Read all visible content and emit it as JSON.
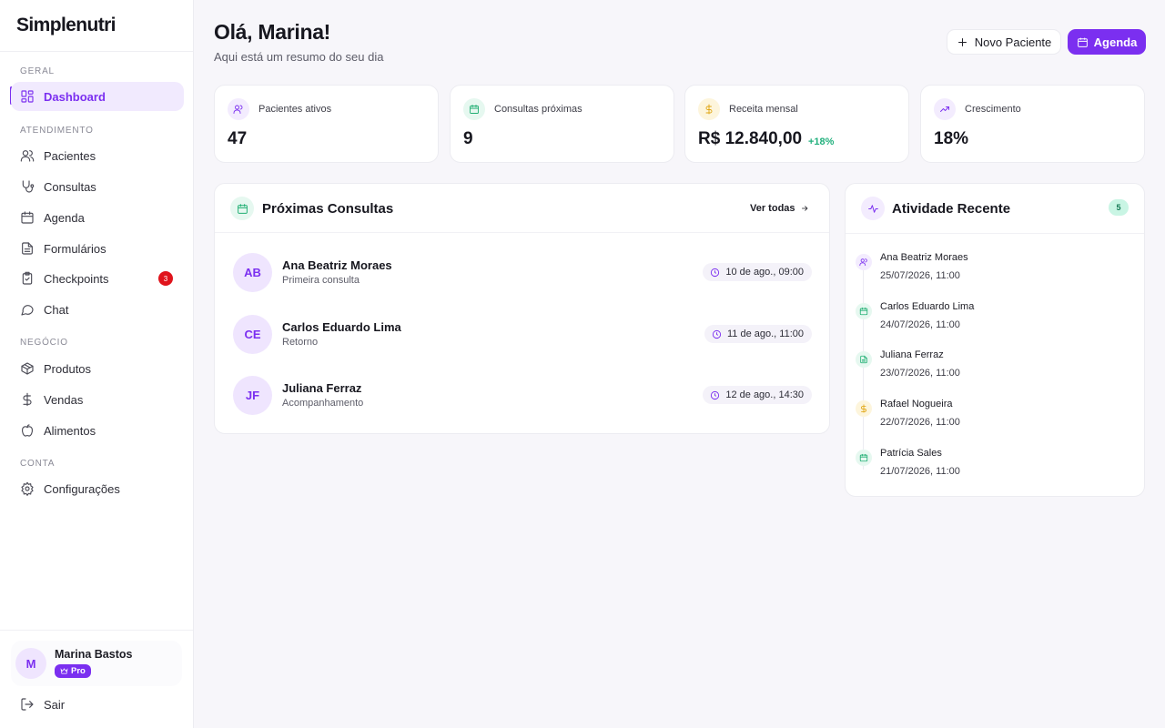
{
  "app": {
    "brand": "Simplenutri"
  },
  "sidebar": {
    "sections": {
      "geral": "GERAL",
      "atendimento": "ATENDIMENTO",
      "negocio": "NEGÓCIO",
      "conta": "CONTA"
    },
    "items": {
      "dashboard": "Dashboard",
      "pacientes": "Pacientes",
      "consultas": "Consultas",
      "agenda": "Agenda",
      "formularios": "Formulários",
      "checkpoints": "Checkpoints",
      "chat": "Chat",
      "produtos": "Produtos",
      "vendas": "Vendas",
      "alimentos": "Alimentos",
      "configuracoes": "Configurações"
    },
    "checkpoints_badge": "3",
    "user": {
      "initial": "M",
      "name": "Marina Bastos",
      "plan": "Pro"
    },
    "logout": "Sair"
  },
  "header": {
    "greeting": "Olá, Marina!",
    "subtitle": "Aqui está um resumo do seu dia",
    "new_patient": "Novo Paciente",
    "agenda": "Agenda"
  },
  "stats": [
    {
      "label": "Pacientes ativos",
      "value": "47",
      "icon": "users-icon",
      "color": "#7b2ff0",
      "bg": "#f3ecfe"
    },
    {
      "label": "Consultas próximas",
      "value": "9",
      "icon": "calendar-icon",
      "color": "#1fae72",
      "bg": "#e6f8f0"
    },
    {
      "label": "Receita mensal",
      "value": "R$ 12.840,00",
      "delta": "+18%",
      "icon": "dollar-icon",
      "color": "#e0a512",
      "bg": "#fdf5dc"
    },
    {
      "label": "Crescimento",
      "value": "18%",
      "icon": "trending-up-icon",
      "color": "#7b2ff0",
      "bg": "#f3ecfe"
    }
  ],
  "upcoming": {
    "title": "Próximas Consultas",
    "view_all": "Ver todas",
    "items": [
      {
        "initials": "AB",
        "name": "Ana Beatriz Moraes",
        "type": "Primeira consulta",
        "when": "10 de ago., 09:00"
      },
      {
        "initials": "CE",
        "name": "Carlos Eduardo Lima",
        "type": "Retorno",
        "when": "11 de ago., 11:00"
      },
      {
        "initials": "JF",
        "name": "Juliana Ferraz",
        "type": "Acompanhamento",
        "when": "12 de ago., 14:30"
      }
    ]
  },
  "activity": {
    "title": "Atividade Recente",
    "count": "5",
    "items": [
      {
        "name": "Ana Beatriz Moraes",
        "date": "25/07/2026, 11:00",
        "icon": "users-icon",
        "color": "#7b2ff0",
        "bg": "#f3ecfe"
      },
      {
        "name": "Carlos Eduardo Lima",
        "date": "24/07/2026, 11:00",
        "icon": "calendar-icon",
        "color": "#1fae72",
        "bg": "#e6f8f0"
      },
      {
        "name": "Juliana Ferraz",
        "date": "23/07/2026, 11:00",
        "icon": "file-icon",
        "color": "#1fae72",
        "bg": "#e6f8f0"
      },
      {
        "name": "Rafael Nogueira",
        "date": "22/07/2026, 11:00",
        "icon": "dollar-icon",
        "color": "#e0a512",
        "bg": "#fdf5dc"
      },
      {
        "name": "Patrícia Sales",
        "date": "21/07/2026, 11:00",
        "icon": "calendar-icon",
        "color": "#1fae72",
        "bg": "#e6f8f0"
      }
    ]
  }
}
